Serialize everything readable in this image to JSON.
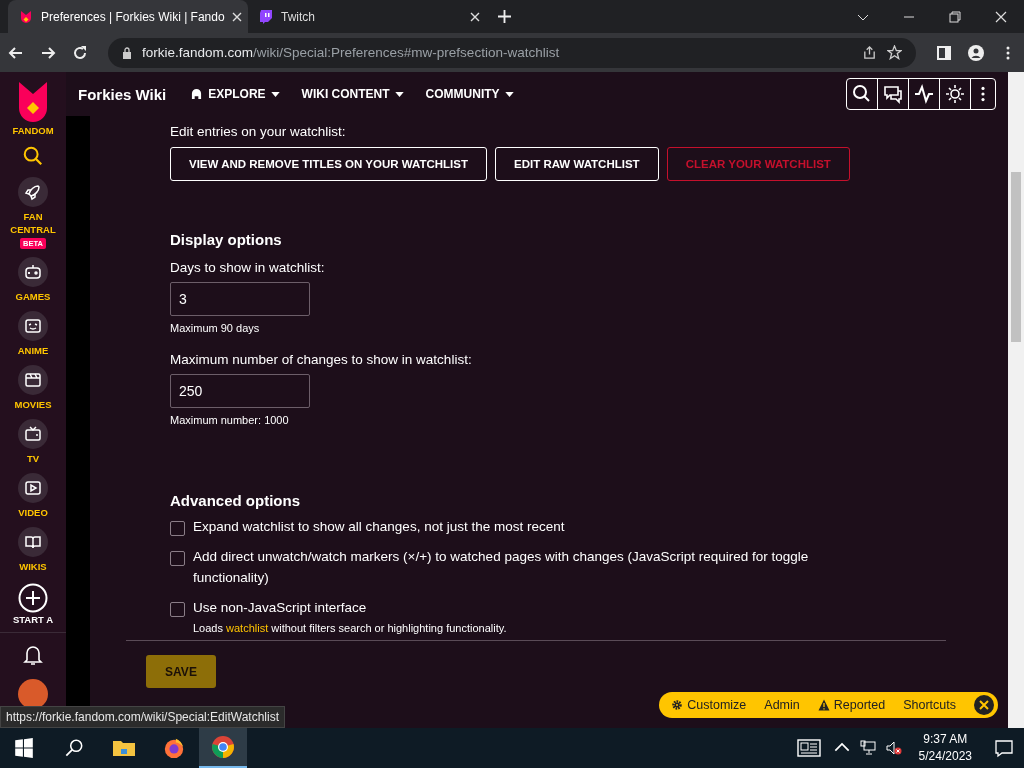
{
  "browser": {
    "tabs": [
      {
        "title": "Preferences | Forkies Wiki | Fando",
        "kind": "fandom",
        "selected": true
      },
      {
        "title": "Twitch",
        "kind": "twitch",
        "selected": false
      }
    ],
    "url_host": "forkie.fandom.com",
    "url_path": "/wiki/Special:Preferences#mw-prefsection-watchlist"
  },
  "sidebar": {
    "logo": "FANDOM",
    "items": [
      {
        "label": "FAN CENTRAL",
        "badge": "BETA",
        "kind": "rocket"
      },
      {
        "label": "GAMES",
        "kind": "gamepad"
      },
      {
        "label": "ANIME",
        "kind": "anime"
      },
      {
        "label": "MOVIES",
        "kind": "movie"
      },
      {
        "label": "TV",
        "kind": "tv"
      },
      {
        "label": "VIDEO",
        "kind": "video"
      },
      {
        "label": "WIKIS",
        "kind": "book"
      }
    ],
    "start": "START A"
  },
  "header": {
    "wiki_name": "Forkies Wiki",
    "nav": [
      {
        "label": "EXPLORE"
      },
      {
        "label": "WIKI CONTENT"
      },
      {
        "label": "COMMUNITY"
      }
    ]
  },
  "watchlist": {
    "label": "Edit entries on your watchlist:",
    "buttons": [
      {
        "label": "VIEW AND REMOVE TITLES ON YOUR WATCHLIST",
        "kind": "outline"
      },
      {
        "label": "EDIT RAW WATCHLIST",
        "kind": "outline"
      },
      {
        "label": "CLEAR YOUR WATCHLIST",
        "kind": "danger"
      }
    ]
  },
  "display_options": {
    "heading": "Display options",
    "fields": [
      {
        "label": "Days to show in watchlist:",
        "value": "3",
        "hint": "Maximum 90 days"
      },
      {
        "label": "Maximum number of changes to show in watchlist:",
        "value": "250",
        "hint": "Maximum number: 1000"
      }
    ]
  },
  "advanced_options": {
    "heading": "Advanced options",
    "checkboxes": [
      {
        "label": "Expand watchlist to show all changes, not just the most recent",
        "checked": false
      },
      {
        "label": "Add direct unwatch/watch markers (×/+) to watched pages with changes (JavaScript required for toggle functionality)",
        "checked": false
      },
      {
        "label": "Use non-JavaScript interface",
        "checked": false,
        "note": {
          "before": "Loads ",
          "link": "watchlist",
          "after": " without filters search or highlighting functionality."
        }
      }
    ]
  },
  "save_button": "SAVE",
  "toolbar": [
    {
      "label": "Customize",
      "kind": "gear"
    },
    {
      "label": "Admin",
      "kind": "plain"
    },
    {
      "label": "Reported",
      "kind": "warning"
    },
    {
      "label": "Shortcuts",
      "kind": "plain"
    }
  ],
  "status_url": "https://forkie.fandom.com/wiki/Special:EditWatchlist",
  "taskbar": {
    "time": "9:37 AM",
    "date": "5/24/2023"
  }
}
